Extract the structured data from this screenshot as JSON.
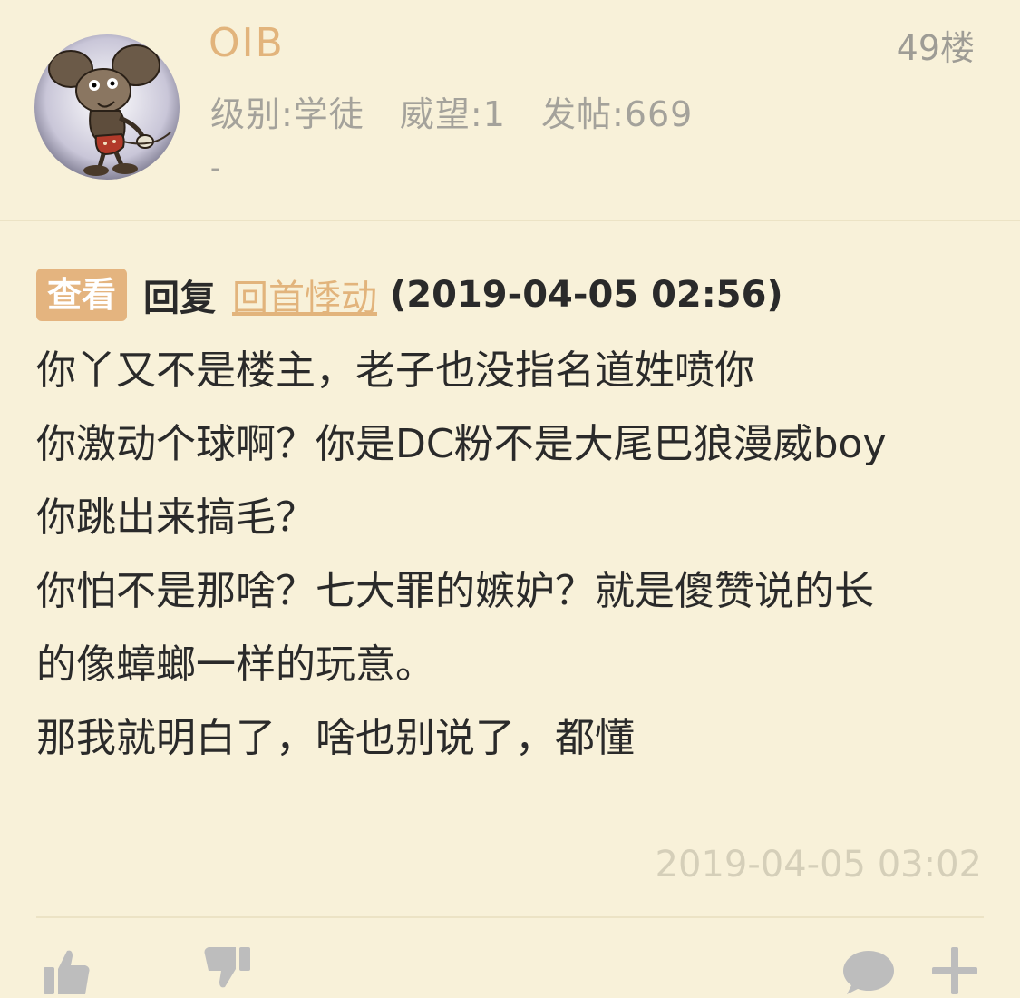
{
  "post": {
    "username": "OIB",
    "floor": "49楼",
    "meta": {
      "level": "级别:学徒",
      "prestige": "威望:1",
      "posts": "发帖:669"
    },
    "signature": "-",
    "quote": {
      "view_label": "查看",
      "reply_word": "回复",
      "reply_user": "回首悸动",
      "reply_time": "(2019-04-05 02:56)"
    },
    "content_lines": [
      "你丫又不是楼主，老子也没指名道姓喷你",
      "你激动个球啊？你是DC粉不是大尾巴狼漫威boy",
      "你跳出来搞毛？",
      "你怕不是那啥？七大罪的嫉妒？就是傻赞说的长",
      "的像蟑螂一样的玩意。",
      "那我就明白了，啥也别说了，都懂"
    ],
    "post_time": "2019-04-05 03:02"
  },
  "actions": {
    "like_icon": "thumbs-up-icon",
    "dislike_icon": "thumbs-down-icon",
    "comment_icon": "comment-icon",
    "more_icon": "plus-icon"
  },
  "colors": {
    "background": "#f8f1d9",
    "accent": "#e2b47c",
    "muted": "#a4a29b"
  }
}
